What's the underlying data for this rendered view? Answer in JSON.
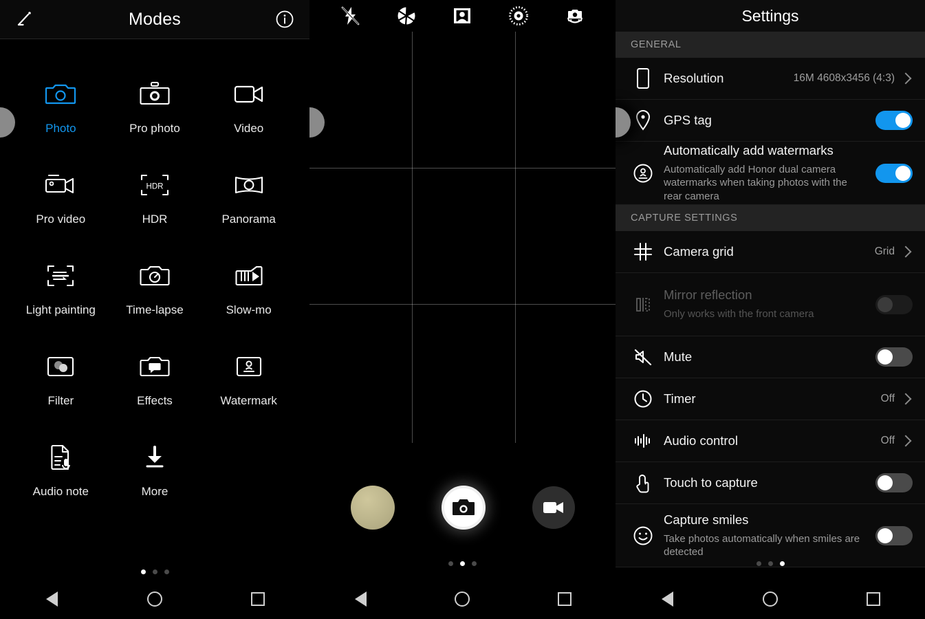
{
  "modes": {
    "header": {
      "title": "Modes",
      "edit_icon": "pencil-edit-icon",
      "info_icon": "info-circle-icon"
    },
    "items": [
      {
        "label": "Photo",
        "icon": "camera-icon",
        "selected": true
      },
      {
        "label": "Pro photo",
        "icon": "pro-camera-icon",
        "selected": false
      },
      {
        "label": "Video",
        "icon": "video-camera-icon",
        "selected": false
      },
      {
        "label": "Pro video",
        "icon": "pro-video-icon",
        "selected": false
      },
      {
        "label": "HDR",
        "icon": "hdr-icon",
        "selected": false
      },
      {
        "label": "Panorama",
        "icon": "panorama-icon",
        "selected": false
      },
      {
        "label": "Light painting",
        "icon": "light-painting-icon",
        "selected": false
      },
      {
        "label": "Time-lapse",
        "icon": "time-lapse-icon",
        "selected": false
      },
      {
        "label": "Slow-mo",
        "icon": "slow-motion-icon",
        "selected": false
      },
      {
        "label": "Filter",
        "icon": "filter-icon",
        "selected": false
      },
      {
        "label": "Effects",
        "icon": "effects-icon",
        "selected": false
      },
      {
        "label": "Watermark",
        "icon": "watermark-stamp-icon",
        "selected": false
      },
      {
        "label": "Audio note",
        "icon": "audio-note-icon",
        "selected": false
      },
      {
        "label": "More",
        "icon": "download-more-icon",
        "selected": false
      }
    ],
    "page_dots": {
      "count": 3,
      "active_index": 0
    }
  },
  "viewfinder": {
    "top_icons": [
      {
        "name": "flash-off-icon"
      },
      {
        "name": "aperture-icon"
      },
      {
        "name": "portrait-beauty-icon"
      },
      {
        "name": "moving-picture-icon"
      },
      {
        "name": "switch-camera-icon"
      }
    ],
    "grid": {
      "enabled": true,
      "rows": 3,
      "columns": 3
    },
    "controls": {
      "gallery_thumbnail": "gallery-thumbnail",
      "shutter": "shutter-button",
      "video_record": "video-record-button"
    },
    "page_dots": {
      "count": 3,
      "active_index": 1
    }
  },
  "settings": {
    "title": "Settings",
    "page_dots": {
      "count": 3,
      "active_index": 2
    },
    "sections": [
      {
        "label": "GENERAL",
        "rows": [
          {
            "title": "Resolution",
            "subtitle": "",
            "icon": "resolution-phone-icon",
            "control": "chevron",
            "value": "16M 4608x3456 (4:3)",
            "disabled": false
          },
          {
            "title": "GPS tag",
            "subtitle": "",
            "icon": "location-pin-icon",
            "control": "toggle",
            "value": "on",
            "disabled": false
          },
          {
            "title": "Automatically add watermarks",
            "subtitle": "Automatically add Honor dual camera watermarks when taking photos with the rear camera",
            "icon": "watermark-stamp-circle-icon",
            "control": "toggle",
            "value": "on",
            "disabled": false
          }
        ]
      },
      {
        "label": "CAPTURE SETTINGS",
        "rows": [
          {
            "title": "Camera grid",
            "subtitle": "",
            "icon": "grid-hash-icon",
            "control": "chevron",
            "value": "Grid",
            "disabled": false
          },
          {
            "title": "Mirror reflection",
            "subtitle": "Only works with the front camera",
            "icon": "mirror-reflection-icon",
            "control": "toggle",
            "value": "off",
            "disabled": true
          },
          {
            "title": "Mute",
            "subtitle": "",
            "icon": "mute-speaker-icon",
            "control": "toggle",
            "value": "off",
            "disabled": false
          },
          {
            "title": "Timer",
            "subtitle": "",
            "icon": "clock-timer-icon",
            "control": "chevron",
            "value": "Off",
            "disabled": false
          },
          {
            "title": "Audio control",
            "subtitle": "",
            "icon": "audio-waveform-icon",
            "control": "chevron",
            "value": "Off",
            "disabled": false
          },
          {
            "title": "Touch to capture",
            "subtitle": "",
            "icon": "touch-hand-icon",
            "control": "toggle",
            "value": "off",
            "disabled": false
          },
          {
            "title": "Capture smiles",
            "subtitle": "Take photos automatically when smiles are detected",
            "icon": "smiley-face-icon",
            "control": "toggle",
            "value": "off",
            "disabled": false
          }
        ]
      }
    ]
  },
  "navbar": {
    "back": "back-triangle-icon",
    "home": "home-circle-icon",
    "recents": "recents-square-icon"
  },
  "colors": {
    "accent_blue": "#1296ee",
    "panel_black": "#000000",
    "section_header_bg": "#232323",
    "divider": "#1e1e1e"
  }
}
